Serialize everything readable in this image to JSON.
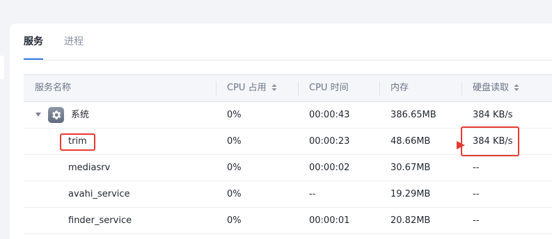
{
  "tabs": {
    "services": "服务",
    "processes": "进程"
  },
  "columns": {
    "name": "服务名称",
    "cpu_usage": "CPU 占用",
    "cpu_time": "CPU 时间",
    "memory": "内存",
    "disk_read": "硬盘读取"
  },
  "rows": [
    {
      "name": "系统",
      "cpu": "0%",
      "time": "00:00:43",
      "mem": "386.65MB",
      "disk": "384 KB/s"
    },
    {
      "name": "trim",
      "cpu": "0%",
      "time": "00:00:23",
      "mem": "48.66MB",
      "disk": "384 KB/s"
    },
    {
      "name": "mediasrv",
      "cpu": "0%",
      "time": "00:00:02",
      "mem": "30.67MB",
      "disk": "--"
    },
    {
      "name": "avahi_service",
      "cpu": "0%",
      "time": "--",
      "mem": "19.29MB",
      "disk": "--"
    },
    {
      "name": "finder_service",
      "cpu": "0%",
      "time": "00:00:01",
      "mem": "20.82MB",
      "disk": "--"
    }
  ],
  "colors": {
    "accent": "#2d7ae5",
    "annotation": "#e53a2f"
  }
}
